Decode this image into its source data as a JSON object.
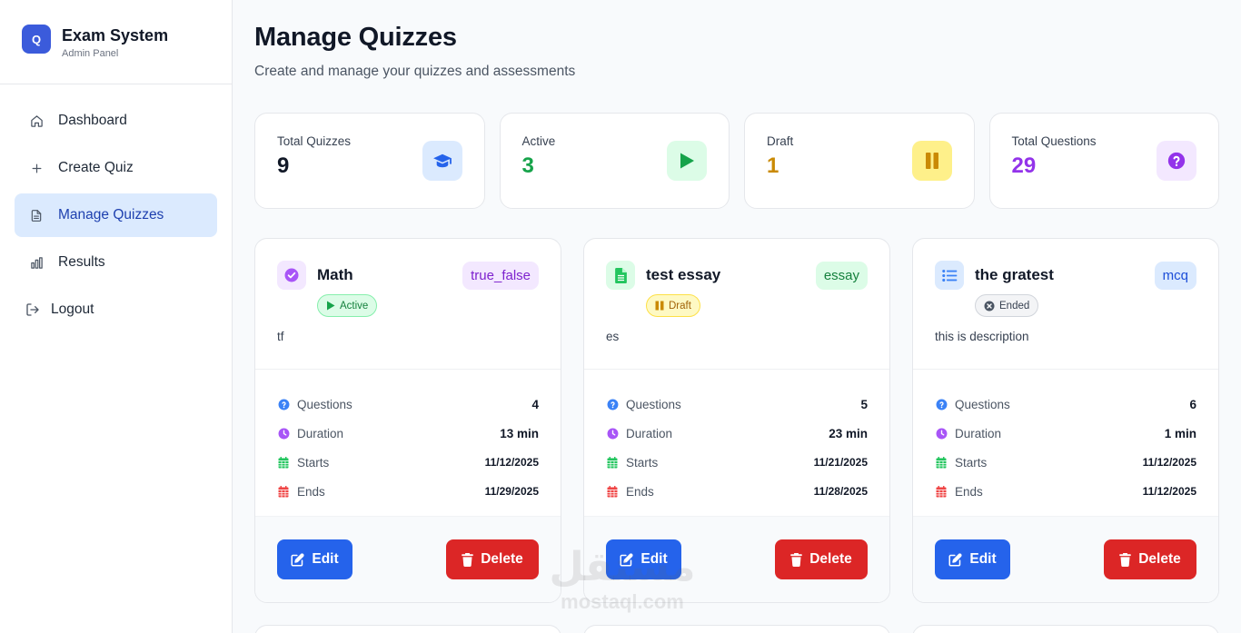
{
  "sidebar": {
    "logo_letter": "Q",
    "title": "Exam System",
    "subtitle": "Admin Panel",
    "items": [
      {
        "label": "Dashboard",
        "icon": "home-icon",
        "active": false
      },
      {
        "label": "Create Quiz",
        "icon": "plus-icon",
        "active": false
      },
      {
        "label": "Manage Quizzes",
        "icon": "document-icon",
        "active": true
      },
      {
        "label": "Results",
        "icon": "bar-chart-icon",
        "active": false
      },
      {
        "label": "Logout",
        "icon": "logout-icon",
        "active": false
      }
    ]
  },
  "header": {
    "title": "Manage Quizzes",
    "subtitle": "Create and manage your quizzes and assessments"
  },
  "stats": [
    {
      "label": "Total Quizzes",
      "value": "9",
      "icon": "graduation-cap-icon",
      "color": "#111827",
      "icon_color": "#2563eb",
      "icon_bg": "#dbeafe"
    },
    {
      "label": "Active",
      "value": "3",
      "icon": "play-icon",
      "color": "#16a34a",
      "icon_color": "#16a34a",
      "icon_bg": "#dcfce7"
    },
    {
      "label": "Draft",
      "value": "1",
      "icon": "pause-icon",
      "color": "#ca8a04",
      "icon_color": "#ca8a04",
      "icon_bg": "#fef9c3"
    },
    {
      "label": "Total Questions",
      "value": "29",
      "icon": "question-circle-icon",
      "color": "#9333ea",
      "icon_color": "#9333ea",
      "icon_bg": "#f3e8ff"
    }
  ],
  "quizzes": [
    {
      "title": "Math",
      "type": "true_false",
      "type_icon": "check-circle-icon",
      "status": "Active",
      "status_icon": "play-icon",
      "description": "tf",
      "questions_label": "Questions",
      "questions": "4",
      "duration_label": "Duration",
      "duration": "13 min",
      "starts_label": "Starts",
      "starts": "11/12/2025",
      "ends_label": "Ends",
      "ends": "11/29/2025",
      "edit_label": "Edit",
      "delete_label": "Delete"
    },
    {
      "title": "test essay",
      "type": "essay",
      "type_icon": "file-text-icon",
      "status": "Draft",
      "status_icon": "pause-icon",
      "description": "es",
      "questions_label": "Questions",
      "questions": "5",
      "duration_label": "Duration",
      "duration": "23 min",
      "starts_label": "Starts",
      "starts": "11/21/2025",
      "ends_label": "Ends",
      "ends": "11/28/2025",
      "edit_label": "Edit",
      "delete_label": "Delete"
    },
    {
      "title": "the gratest",
      "type": "mcq",
      "type_icon": "list-icon",
      "status": "Ended",
      "status_icon": "x-circle-icon",
      "description": "this is description",
      "questions_label": "Questions",
      "questions": "6",
      "duration_label": "Duration",
      "duration": "1 min",
      "starts_label": "Starts",
      "starts": "11/12/2025",
      "ends_label": "Ends",
      "ends": "11/12/2025",
      "edit_label": "Edit",
      "delete_label": "Delete"
    }
  ],
  "watermark": {
    "arabic": "مستقل",
    "latin": "mostaql.com"
  },
  "colors": {
    "primary": "#2563eb",
    "danger": "#dc2626",
    "active_nav_bg": "#dbeafe",
    "active_nav_text": "#1e40af"
  }
}
